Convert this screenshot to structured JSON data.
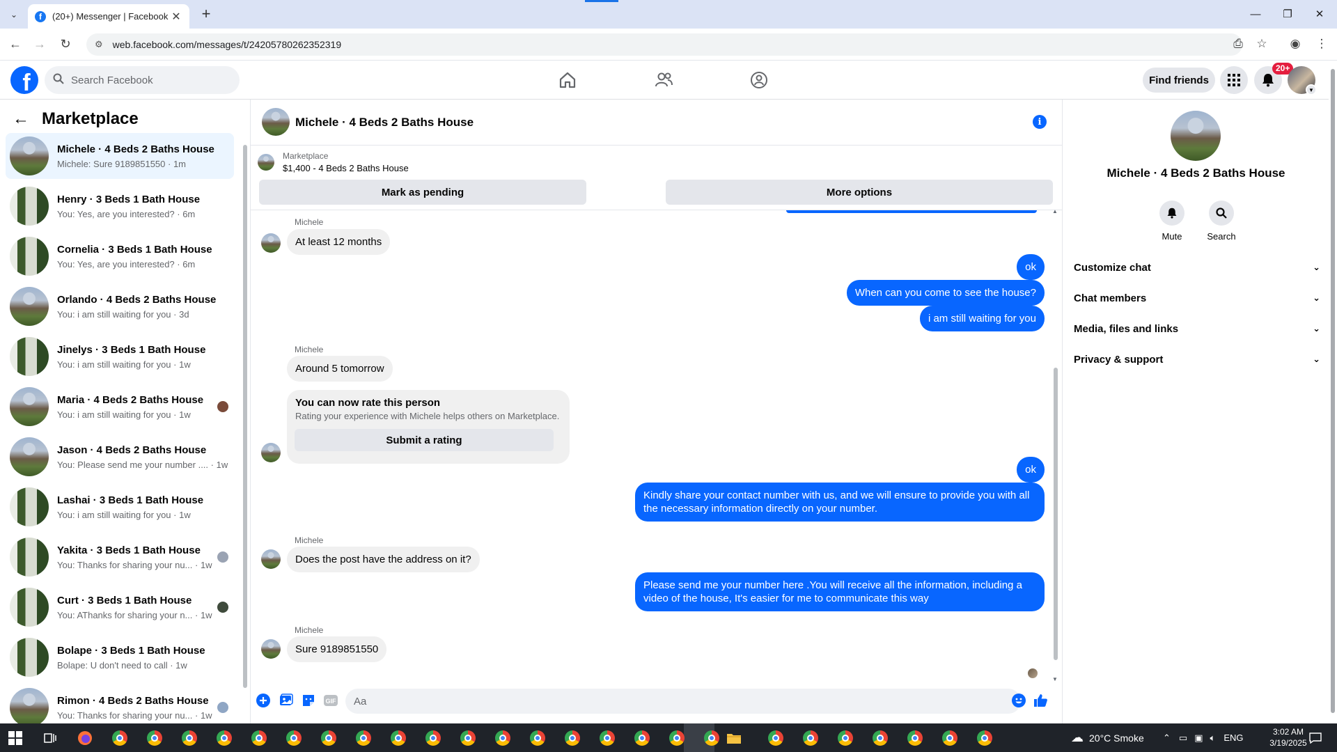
{
  "browser": {
    "tab_title": "(20+) Messenger | Facebook",
    "favicon": "f",
    "url": "web.facebook.com/messages/t/24205780262352319",
    "new_tab_label": "+",
    "close_tab_label": "✕",
    "window_controls": [
      "—",
      "❐",
      "✕"
    ]
  },
  "fb": {
    "search_placeholder": "Search Facebook",
    "find_friends_label": "Find friends",
    "notif_badge": "20+",
    "logo_letter": "f"
  },
  "left": {
    "title": "Marketplace",
    "chats": [
      {
        "name": "Michele · 4 Beds 2 Baths House",
        "preview": "Michele: Sure 9189851550 · 1m",
        "active": true,
        "thumb": "a",
        "seen": ""
      },
      {
        "name": "Henry · 3 Beds 1 Bath House",
        "preview": "You: Yes, are you interested? · 6m",
        "thumb": "b",
        "seen": ""
      },
      {
        "name": "Cornelia · 3 Beds 1 Bath House",
        "preview": "You: Yes, are you interested? · 6m",
        "thumb": "b",
        "seen": ""
      },
      {
        "name": "Orlando · 4 Beds 2 Baths House",
        "preview": "You: i am still waiting for you · 3d",
        "thumb": "a",
        "seen": ""
      },
      {
        "name": "Jinelys · 3 Beds 1 Bath House",
        "preview": "You: i am still waiting for you · 1w",
        "thumb": "b",
        "seen": ""
      },
      {
        "name": "Maria · 4 Beds 2 Baths House",
        "preview": "You: i am still waiting for you · 1w",
        "thumb": "a",
        "seen": "#7a4b3a"
      },
      {
        "name": "Jason · 4 Beds 2 Baths House",
        "preview": "You: Please send me your number .... · 1w",
        "thumb": "a",
        "seen": ""
      },
      {
        "name": "Lashai · 3 Beds 1 Bath House",
        "preview": "You: i am still waiting for you · 1w",
        "thumb": "b",
        "seen": ""
      },
      {
        "name": "Yakita · 3 Beds 1 Bath House",
        "preview": "You: Thanks for sharing your nu... · 1w",
        "thumb": "b",
        "seen": "#9aa3b3"
      },
      {
        "name": "Curt · 3 Beds 1 Bath House",
        "preview": "You: AThanks for sharing your n... · 1w",
        "thumb": "b",
        "seen": "#3f4b3c"
      },
      {
        "name": "Bolape · 3 Beds 1 Bath House",
        "preview": "Bolape: U don't need to call · 1w",
        "thumb": "b",
        "seen": ""
      },
      {
        "name": "Rimon · 4 Beds 2 Baths House",
        "preview": "You: Thanks for sharing your nu... · 1w",
        "thumb": "a",
        "seen": "#8fa6c4"
      }
    ]
  },
  "conversation": {
    "title": "Michele · 4 Beds 2 Baths House",
    "marketplace_label": "Marketplace",
    "listing": "$1,400 - 4 Beds 2 Baths House",
    "mark_pending": "Mark as pending",
    "more_options": "More options",
    "sender_name": "Michele",
    "messages": {
      "in1": "At least 12 months",
      "out1": "ok",
      "out2": "When can you come to see the house?",
      "out3": "i am still waiting for you",
      "in2": "Around 5 tomorrow",
      "out4": "ok",
      "out5": "Kindly share your contact number with us, and we will ensure to provide you with all the necessary information directly on your number.",
      "in3": "Does the post have the address on it?",
      "out6": "Please send me your number here .You will receive all the information, including a video of the house,  It's easier for me to communicate this way",
      "in4": "Sure 9189851550"
    },
    "rating": {
      "title": "You can now rate this person",
      "subtitle": "Rating your experience with Michele helps others on Marketplace.",
      "button": "Submit a rating"
    },
    "composer_placeholder": "Aa"
  },
  "right": {
    "name": "Michele · 4 Beds 2 Baths House",
    "mute_label": "Mute",
    "search_label": "Search",
    "sections": [
      "Customize chat",
      "Chat members",
      "Media, files and links",
      "Privacy & support"
    ]
  },
  "taskbar": {
    "weather": "20°C  Smoke",
    "language": "ENG",
    "time": "3:02 AM",
    "date": "3/19/2025"
  },
  "colors": {
    "fb_blue": "#0866ff",
    "bubble_in": "#f0f0f0",
    "active_chat": "#ebf5ff",
    "badge_red": "#e41e3f"
  }
}
